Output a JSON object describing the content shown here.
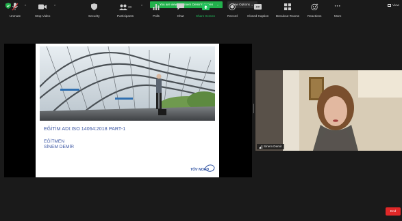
{
  "top_bar": {
    "banner_text": "You are viewing Sinem Demir's screen",
    "view_options_label": "View Options ⌄",
    "view_label": "View"
  },
  "slide": {
    "title": "EĞİTİM ADI:ISO 14064:2018 PART-1",
    "role": "EĞİTMEN",
    "name": "SİNEM DEMİR",
    "logo_text": "TÜV NORD"
  },
  "participant": {
    "name": "Sinem Demir"
  },
  "toolbar": {
    "unmute": "Unmute",
    "stop_video": "Stop Video",
    "security": "Security",
    "participants": "Participants",
    "participant_count": "23",
    "polls": "Polls",
    "chat": "Chat",
    "share_screen": "Share Screen",
    "record": "Record",
    "closed_caption": "Closed Caption",
    "cc_icon_text": "CC",
    "breakout_rooms": "Breakout Rooms",
    "reactions": "Reactions",
    "more": "More",
    "more_icon_text": "•••",
    "end": "End"
  },
  "colors": {
    "banner_green": "#22b14c",
    "share_green": "#22c15e",
    "end_red": "#e02828",
    "slide_blue": "#3b56a3"
  }
}
